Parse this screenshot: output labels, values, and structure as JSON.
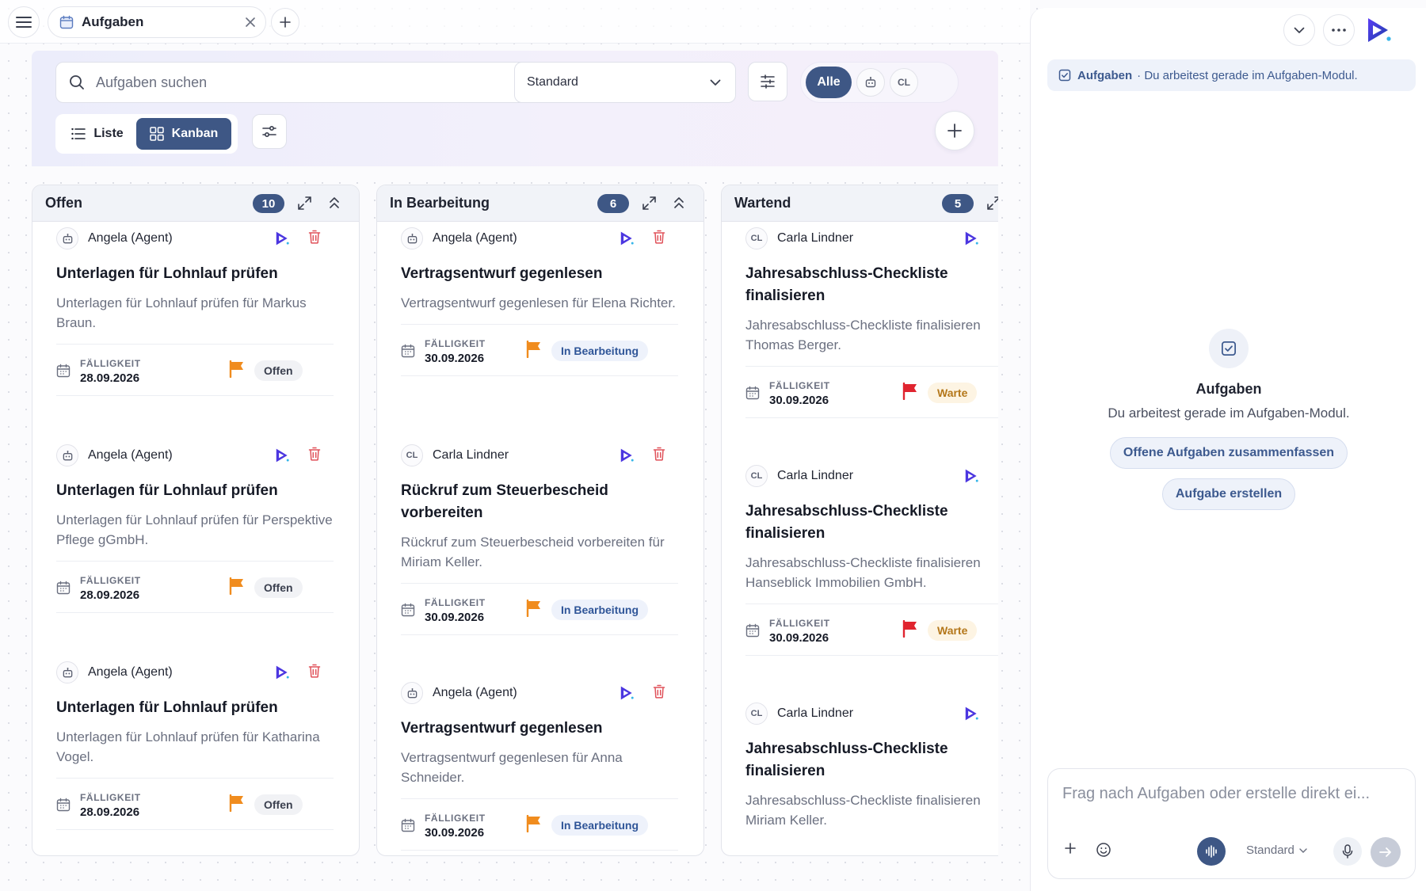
{
  "tabbar": {
    "tab_label": "Aufgaben"
  },
  "toolbar": {
    "search_placeholder": "Aufgaben suchen",
    "view_select": "Standard",
    "assignee_filter": {
      "all_label": "Alle",
      "user_initials": "CL"
    },
    "mode_list_label": "Liste",
    "mode_kanban_label": "Kanban",
    "active_mode": "Kanban"
  },
  "due_label": "FÄLLIGKEIT",
  "columns": [
    {
      "title": "Offen",
      "count": "10",
      "cards": [
        {
          "assignee": "Angela (Agent)",
          "title": "Unterlagen für Lohnlauf prüfen",
          "desc": "Unterlagen für Lohnlauf prüfen für Markus Braun.",
          "due": "28.09.2026",
          "status": "Offen",
          "priority_color": "#f08c1e"
        },
        {
          "assignee": "Angela (Agent)",
          "title": "Unterlagen für Lohnlauf prüfen",
          "desc": "Unterlagen für Lohnlauf prüfen für Perspektive Pflege gGmbH.",
          "due": "28.09.2026",
          "status": "Offen",
          "priority_color": "#f08c1e"
        },
        {
          "assignee": "Angela (Agent)",
          "title": "Unterlagen für Lohnlauf prüfen",
          "desc": "Unterlagen für Lohnlauf prüfen für Katharina Vogel.",
          "due": "28.09.2026",
          "status": "Offen",
          "priority_color": "#f08c1e"
        }
      ]
    },
    {
      "title": "In Bearbeitung",
      "count": "6",
      "cards": [
        {
          "assignee": "Angela (Agent)",
          "title": "Vertragsentwurf gegenlesen",
          "desc": "Vertragsentwurf gegenlesen für Elena Richter.",
          "due": "30.09.2026",
          "status": "In Bearbeitung",
          "priority_color": "#f08c1e"
        },
        {
          "assignee": "Carla Lindner",
          "initials": "CL",
          "title": "Rückruf zum Steuerbescheid vorbereiten",
          "desc": "Rückruf zum Steuerbescheid vorbereiten für Miriam Keller.",
          "due": "30.09.2026",
          "status": "In Bearbeitung",
          "priority_color": "#f08c1e"
        },
        {
          "assignee": "Angela (Agent)",
          "title": "Vertragsentwurf gegenlesen",
          "desc": "Vertragsentwurf gegenlesen für Anna Schneider.",
          "due": "30.09.2026",
          "status": "In Bearbeitung",
          "priority_color": "#f08c1e"
        }
      ]
    },
    {
      "title": "Wartend",
      "count": "5",
      "cards": [
        {
          "assignee": "Carla Lindner",
          "initials": "CL",
          "title": "Jahresabschluss-Checkliste finalisieren",
          "desc": "Jahresabschluss-Checkliste finalisieren Thomas Berger.",
          "due": "30.09.2026",
          "status": "Warte",
          "priority_color": "#e0242f"
        },
        {
          "assignee": "Carla Lindner",
          "initials": "CL",
          "title": "Jahresabschluss-Checkliste finalisieren",
          "desc": "Jahresabschluss-Checkliste finalisieren Hanseblick Immobilien GmbH.",
          "due": "30.09.2026",
          "status": "Warte",
          "priority_color": "#e0242f"
        },
        {
          "assignee": "Carla Lindner",
          "initials": "CL",
          "title": "Jahresabschluss-Checkliste finalisieren",
          "desc": "Jahresabschluss-Checkliste finalisieren Miriam Keller."
        }
      ]
    }
  ],
  "assistant": {
    "context_module": "Aufgaben",
    "context_text": "· Du arbeitest gerade im Aufgaben-Modul.",
    "welcome_title": "Aufgaben",
    "welcome_sub": "Du arbeitest gerade im Aufgaben-Modul.",
    "suggestion_1": "Offene Aufgaben zusammenfassen",
    "suggestion_2": "Aufgabe erstellen",
    "input_placeholder": "Frag nach Aufgaben oder erstelle direkt ei...",
    "model_label": "Standard"
  },
  "colors": {
    "accent": "#3e5785",
    "flag_orange": "#f08c1e",
    "flag_red": "#e0242f",
    "delete_red": "#e0525a"
  }
}
